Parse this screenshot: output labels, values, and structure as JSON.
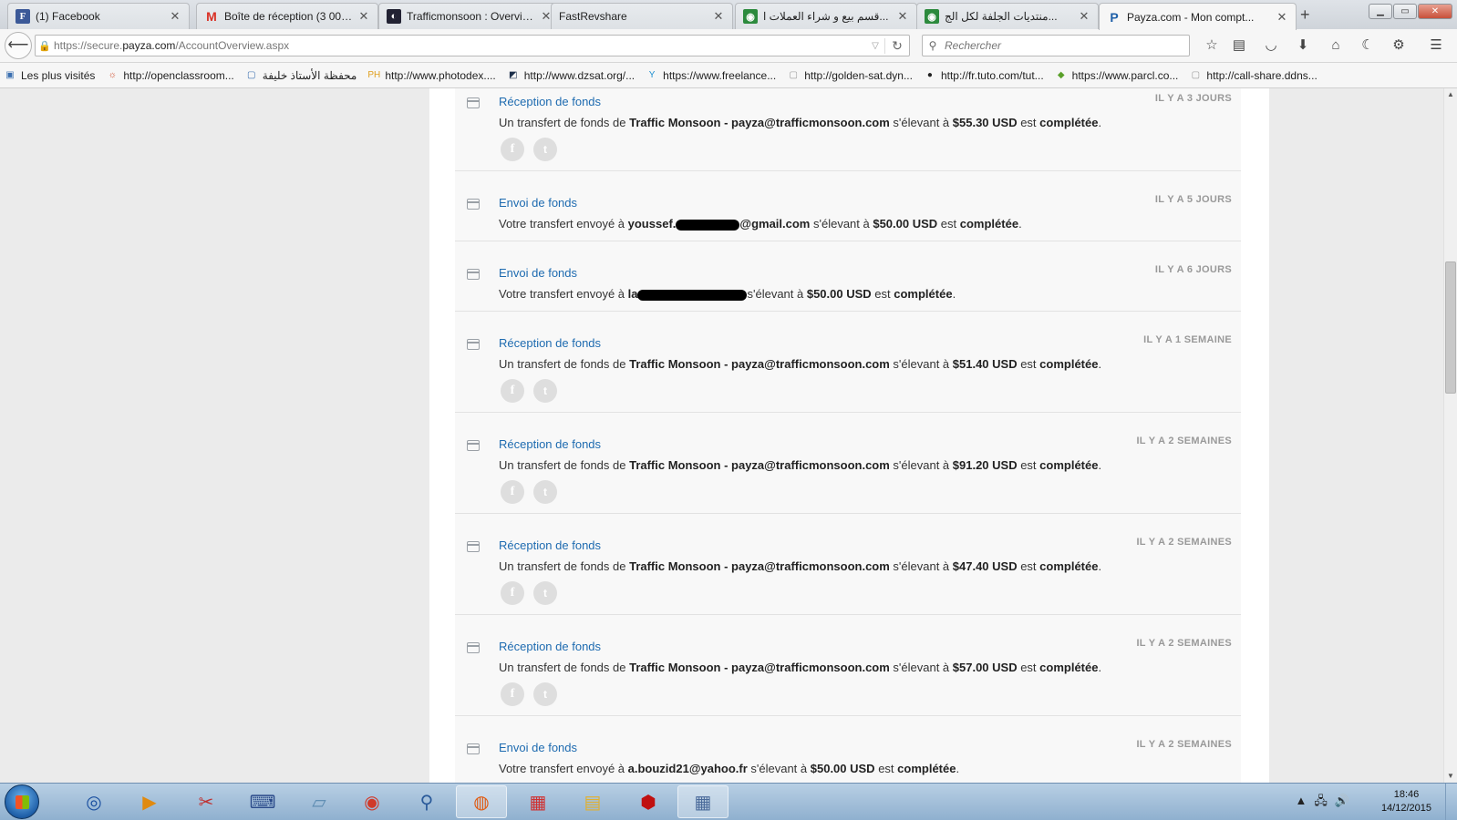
{
  "tabs": [
    {
      "title": "(1) Facebook",
      "favicon": "F",
      "kind": "fb"
    },
    {
      "title": "Boîte de réception (3 003)...",
      "favicon": "M",
      "kind": "gm"
    },
    {
      "title": "Trafficmonsoon : Overview",
      "favicon": "◐",
      "kind": "tm"
    },
    {
      "title": "FastRevshare",
      "favicon": "",
      "kind": "none"
    },
    {
      "title": "قسم بيع و شراء العملات ا...",
      "favicon": "◉",
      "kind": "ar"
    },
    {
      "title": "منتديات الجلفة لكل الج...",
      "favicon": "◉",
      "kind": "ar"
    },
    {
      "title": "Payza.com - Mon compt...",
      "favicon": "P",
      "kind": "p"
    }
  ],
  "nav": {
    "url_prefix": "https://secure.",
    "url_domain": "payza.com",
    "url_path": "/AccountOverview.aspx",
    "search_placeholder": "Rechercher"
  },
  "bookmarks": [
    {
      "label": "Les plus visités",
      "icon": "▣",
      "color": "#3a6fb0"
    },
    {
      "label": "http://openclassroom...",
      "icon": "☼",
      "color": "#d04a2a"
    },
    {
      "label": "محفظة الأستاذ خليفة",
      "icon": "▢",
      "color": "#3a6fb0"
    },
    {
      "label": "http://www.photodex....",
      "icon": "PH",
      "color": "#e0a020"
    },
    {
      "label": "http://www.dzsat.org/...",
      "icon": "◩",
      "color": "#1c2f4a"
    },
    {
      "label": "https://www.freelance...",
      "icon": "Y",
      "color": "#1f8fd0"
    },
    {
      "label": "http://golden-sat.dyn...",
      "icon": "▢",
      "color": "#999"
    },
    {
      "label": "http://fr.tuto.com/tut...",
      "icon": "●",
      "color": "#222"
    },
    {
      "label": "https://www.parcl.co...",
      "icon": "◆",
      "color": "#5aa02a"
    },
    {
      "label": "http://call-share.ddns...",
      "icon": "▢",
      "color": "#999"
    }
  ],
  "feed": [
    {
      "kind": "tall",
      "title": "Réception de fonds",
      "time": "IL Y A 3 JOURS",
      "pre": "Un transfert de fonds de ",
      "party": "Traffic Monsoon - payza@trafficmonsoon.com",
      "party_tail": "",
      "mid": " s'élevant à ",
      "amount": "$55.30 USD",
      "post": " est ",
      "status": "complétée",
      "end": "."
    },
    {
      "kind": "short",
      "title": "Envoi de fonds",
      "time": "IL Y A 5 JOURS",
      "pre": "Votre transfert envoyé à ",
      "party": "youssef.",
      "party_tail": "@gmail.com",
      "redact": 70,
      "mid": " s'élevant à ",
      "amount": "$50.00 USD",
      "post": " est ",
      "status": "complétée",
      "end": "."
    },
    {
      "kind": "short",
      "title": "Envoi de fonds",
      "time": "IL Y A 6 JOURS",
      "pre": "Votre transfert envoyé à ",
      "party": "la",
      "party_tail": "",
      "redact": 120,
      "mid": "s'élevant à ",
      "amount": "$50.00 USD",
      "post": " est ",
      "status": "complétée",
      "end": "."
    },
    {
      "kind": "tall",
      "title": "Réception de fonds",
      "time": "IL Y A 1 SEMAINE",
      "pre": "Un transfert de fonds de ",
      "party": "Traffic Monsoon - payza@trafficmonsoon.com",
      "party_tail": "",
      "mid": " s'élevant à ",
      "amount": "$51.40 USD",
      "post": " est ",
      "status": "complétée",
      "end": "."
    },
    {
      "kind": "tall",
      "title": "Réception de fonds",
      "time": "IL Y A 2 SEMAINES",
      "pre": "Un transfert de fonds de ",
      "party": "Traffic Monsoon - payza@trafficmonsoon.com",
      "party_tail": "",
      "mid": " s'élevant à ",
      "amount": "$91.20 USD",
      "post": " est ",
      "status": "complétée",
      "end": "."
    },
    {
      "kind": "tall",
      "title": "Réception de fonds",
      "time": "IL Y A 2 SEMAINES",
      "pre": "Un transfert de fonds de ",
      "party": "Traffic Monsoon - payza@trafficmonsoon.com",
      "party_tail": "",
      "mid": " s'élevant à ",
      "amount": "$47.40 USD",
      "post": " est ",
      "status": "complétée",
      "end": "."
    },
    {
      "kind": "tall",
      "title": "Réception de fonds",
      "time": "IL Y A 2 SEMAINES",
      "pre": "Un transfert de fonds de ",
      "party": "Traffic Monsoon - payza@trafficmonsoon.com",
      "party_tail": "",
      "mid": " s'élevant à ",
      "amount": "$57.00 USD",
      "post": " est ",
      "status": "complétée",
      "end": "."
    },
    {
      "kind": "short",
      "title": "Envoi de fonds",
      "time": "IL Y A 2 SEMAINES",
      "pre": "Votre transfert envoyé à ",
      "party": "a.bouzid21@yahoo.fr",
      "party_tail": "",
      "mid": " s'élevant à ",
      "amount": "$50.00 USD",
      "post": " est ",
      "status": "complétée",
      "end": "."
    }
  ],
  "social": {
    "facebook_icon": "f",
    "twitter_icon": "t"
  },
  "taskbar": {
    "apps": [
      {
        "name": "itunes",
        "icon": "◎",
        "color": "#1a4fa0",
        "active": false
      },
      {
        "name": "media-player",
        "icon": "▶",
        "color": "#e08a10",
        "active": false
      },
      {
        "name": "snipping-tool",
        "icon": "✂",
        "color": "#c03030",
        "active": false
      },
      {
        "name": "keyboard",
        "icon": "⌨",
        "color": "#2a4a8a",
        "active": false
      },
      {
        "name": "notepad",
        "icon": "▱",
        "color": "#5a8ab0",
        "active": false
      },
      {
        "name": "chrome",
        "icon": "◉",
        "color": "#d03a2a",
        "active": false
      },
      {
        "name": "search",
        "icon": "⚲",
        "color": "#2a5a9a",
        "active": false
      },
      {
        "name": "firefox",
        "icon": "◍",
        "color": "#e05a10",
        "active": true
      },
      {
        "name": "apps-grid",
        "icon": "▦",
        "color": "#d03030",
        "active": false
      },
      {
        "name": "explorer",
        "icon": "▤",
        "color": "#e0b030",
        "active": false
      },
      {
        "name": "antivirus",
        "icon": "⬢",
        "color": "#c01010",
        "active": false
      },
      {
        "name": "calculator",
        "icon": "▦",
        "color": "#4a6a9a",
        "active": true
      }
    ],
    "time": "18:46",
    "date": "14/12/2015"
  }
}
